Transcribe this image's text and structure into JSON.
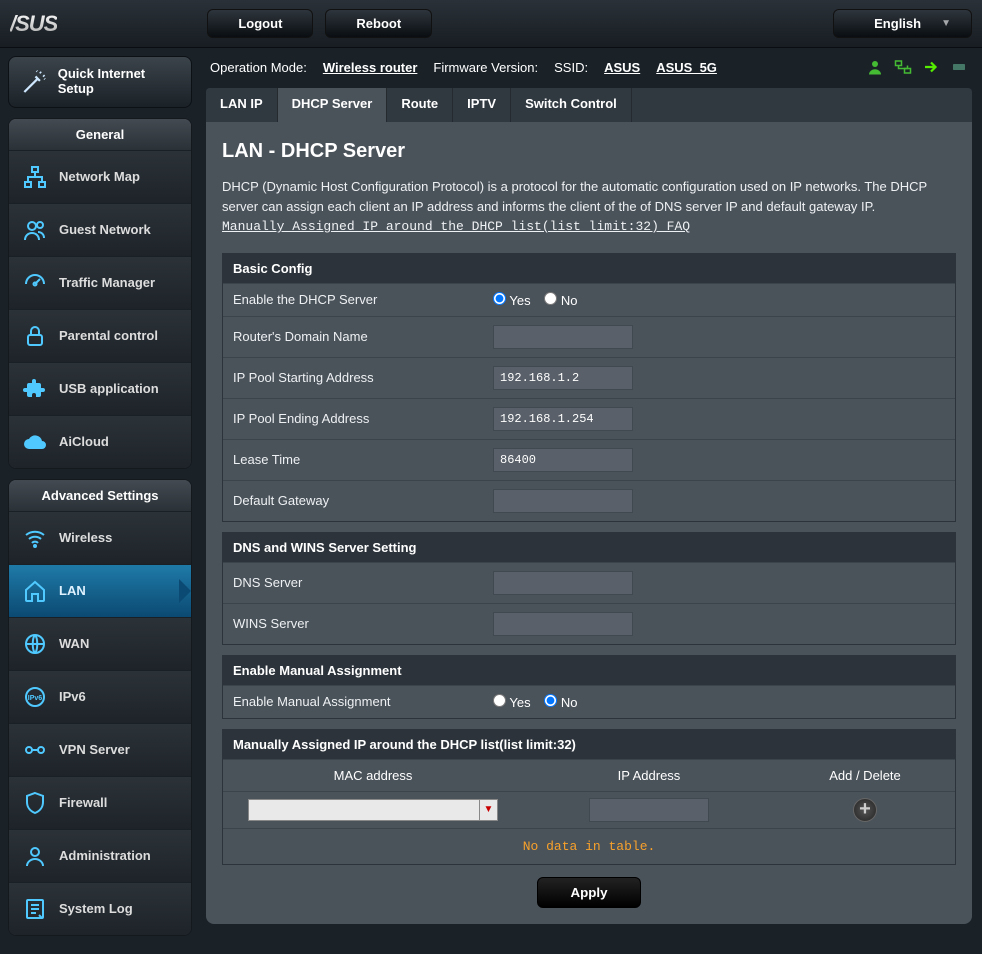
{
  "logo": "/SUS",
  "top": {
    "logout": "Logout",
    "reboot": "Reboot",
    "language": "English"
  },
  "info": {
    "op_mode_label": "Operation Mode:",
    "op_mode_value": "Wireless router",
    "fw_label": "Firmware Version:",
    "ssid_label": "SSID:",
    "ssid1": "ASUS",
    "ssid2": "ASUS_5G"
  },
  "qis": "Quick Internet Setup",
  "menu": {
    "general_head": "General",
    "general": [
      "Network Map",
      "Guest Network",
      "Traffic Manager",
      "Parental control",
      "USB application",
      "AiCloud"
    ],
    "adv_head": "Advanced Settings",
    "adv": [
      "Wireless",
      "LAN",
      "WAN",
      "IPv6",
      "VPN Server",
      "Firewall",
      "Administration",
      "System Log"
    ]
  },
  "tabs": [
    "LAN IP",
    "DHCP Server",
    "Route",
    "IPTV",
    "Switch Control"
  ],
  "page": {
    "title": "LAN - DHCP Server",
    "desc": "DHCP (Dynamic Host Configuration Protocol) is a protocol for the automatic configuration used on IP networks. The DHCP server can assign each client an IP address and informs the client of the of DNS server IP and default gateway IP.",
    "faq": "Manually Assigned IP around the DHCP list(list limit:32) FAQ"
  },
  "basic": {
    "head": "Basic Config",
    "enable_lbl": "Enable the DHCP Server",
    "yes": "Yes",
    "no": "No",
    "domain_lbl": "Router's Domain Name",
    "domain_val": "",
    "start_lbl": "IP Pool Starting Address",
    "start_val": "192.168.1.2",
    "end_lbl": "IP Pool Ending Address",
    "end_val": "192.168.1.254",
    "lease_lbl": "Lease Time",
    "lease_val": "86400",
    "gw_lbl": "Default Gateway",
    "gw_val": ""
  },
  "dns": {
    "head": "DNS and WINS Server Setting",
    "dns_lbl": "DNS Server",
    "dns_val": "",
    "wins_lbl": "WINS Server",
    "wins_val": ""
  },
  "manual": {
    "head": "Enable Manual Assignment",
    "lbl": "Enable Manual Assignment",
    "yes": "Yes",
    "no": "No"
  },
  "table": {
    "head": "Manually Assigned IP around the DHCP list(list limit:32)",
    "col_mac": "MAC address",
    "col_ip": "IP Address",
    "col_act": "Add / Delete",
    "empty": "No data in table."
  },
  "apply": "Apply"
}
